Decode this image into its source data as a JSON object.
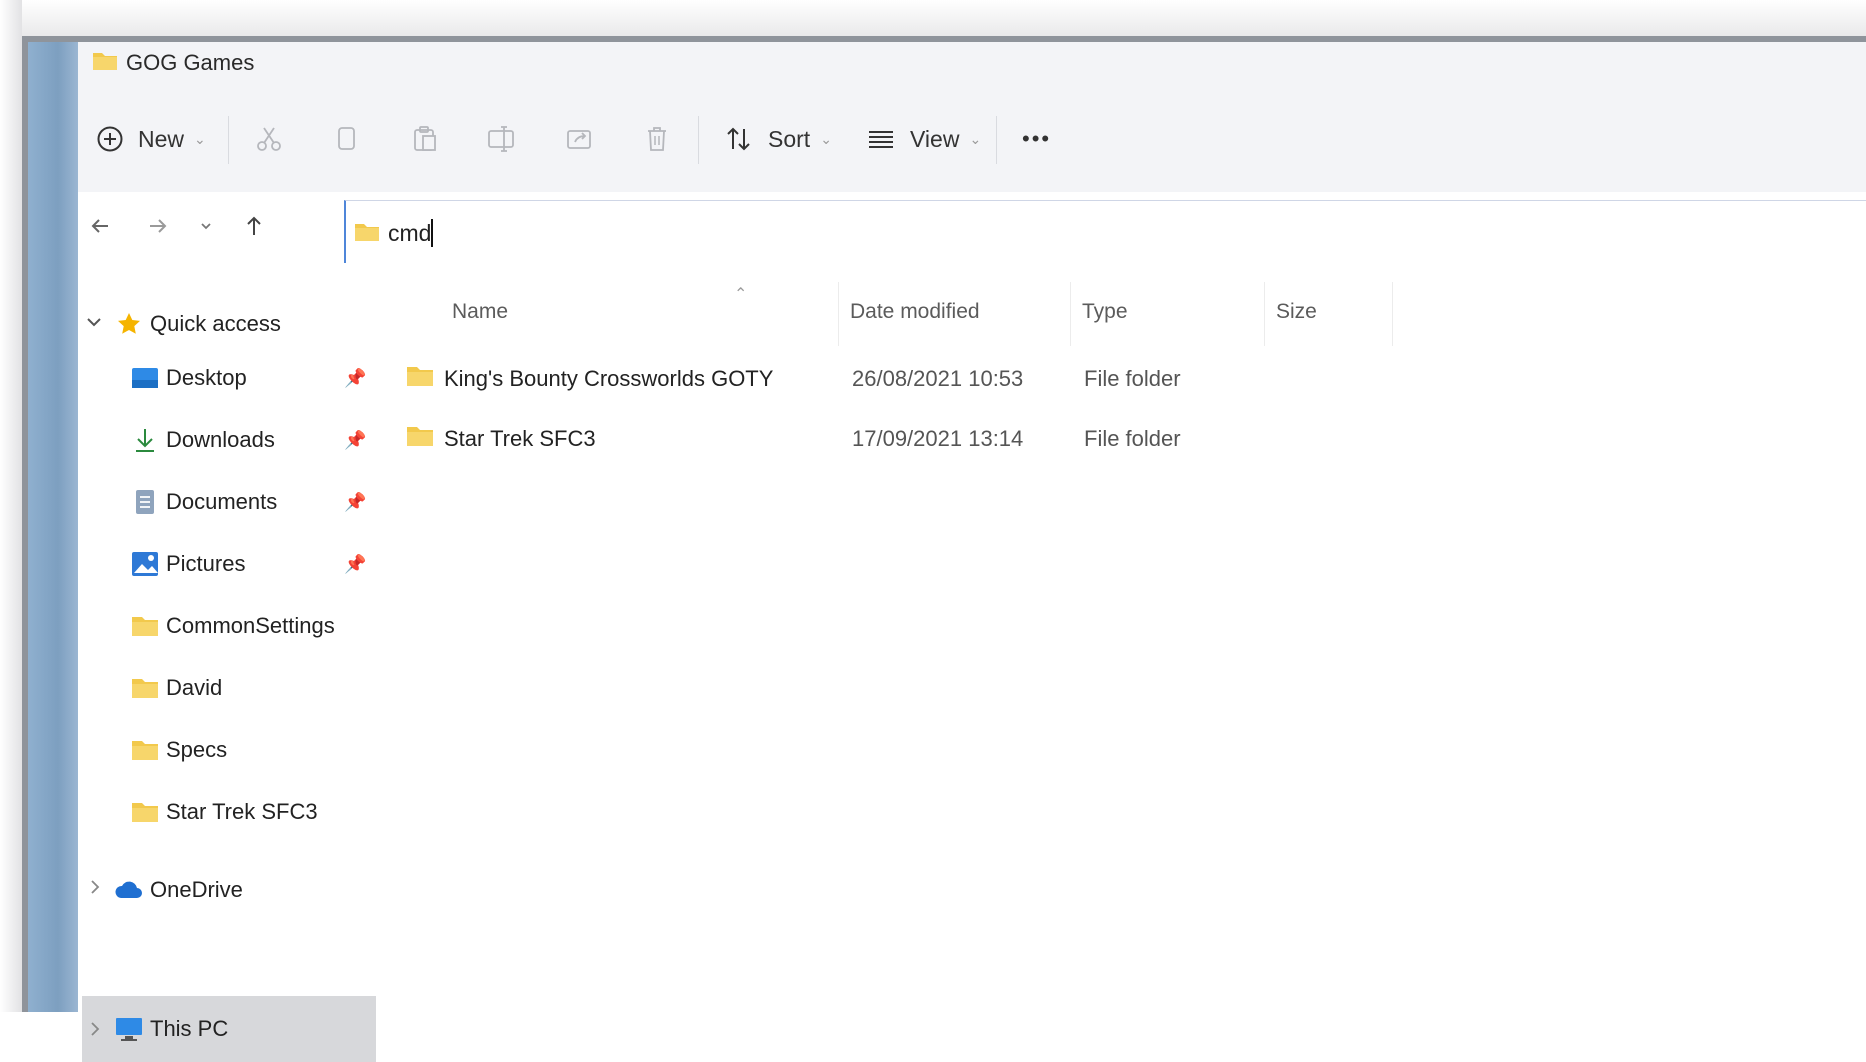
{
  "window": {
    "title": "GOG Games"
  },
  "toolbar": {
    "new_label": "New",
    "sort_label": "Sort",
    "view_label": "View",
    "more_label": "•••"
  },
  "address": {
    "value": "cmd"
  },
  "sidebar": {
    "quick_access": "Quick access",
    "items": [
      {
        "label": "Desktop",
        "icon": "desktop-icon",
        "pinned": true
      },
      {
        "label": "Downloads",
        "icon": "download-icon",
        "pinned": true
      },
      {
        "label": "Documents",
        "icon": "document-icon",
        "pinned": true
      },
      {
        "label": "Pictures",
        "icon": "pictures-icon",
        "pinned": true
      },
      {
        "label": "CommonSettings",
        "icon": "folder-icon",
        "pinned": false
      },
      {
        "label": "David",
        "icon": "folder-icon",
        "pinned": false
      },
      {
        "label": "Specs",
        "icon": "folder-icon",
        "pinned": false
      },
      {
        "label": "Star Trek SFC3",
        "icon": "folder-icon",
        "pinned": false
      }
    ],
    "onedrive": "OneDrive",
    "this_pc": "This PC"
  },
  "columns": {
    "name": "Name",
    "date": "Date modified",
    "type": "Type",
    "size": "Size"
  },
  "files": [
    {
      "name": "King's Bounty Crossworlds GOTY",
      "date": "26/08/2021 10:53",
      "type": "File folder"
    },
    {
      "name": "Star Trek SFC3",
      "date": "17/09/2021 13:14",
      "type": "File folder"
    }
  ],
  "colors": {
    "folder": "#f2c94c",
    "accent": "#4f86d9",
    "selected": "#d7d8db"
  }
}
